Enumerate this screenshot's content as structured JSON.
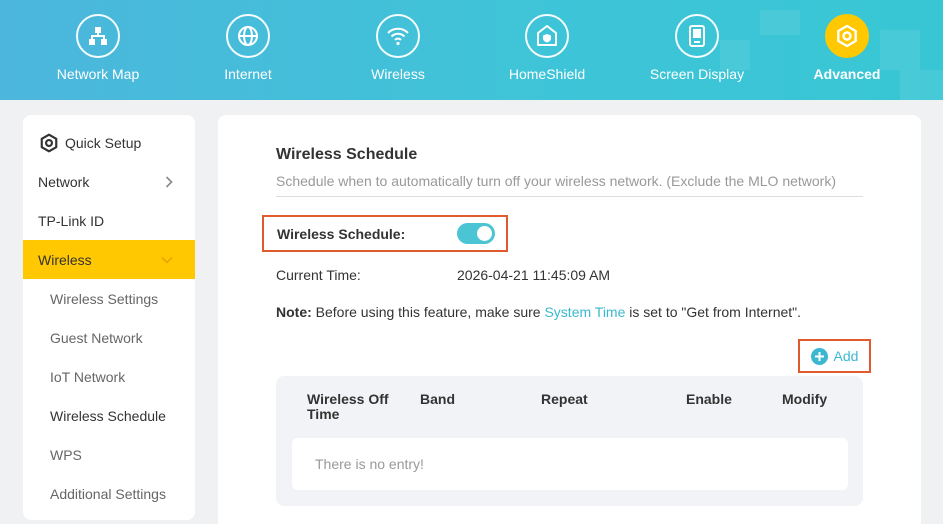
{
  "nav": {
    "items": [
      {
        "label": "Network Map",
        "icon": "network-map-icon"
      },
      {
        "label": "Internet",
        "icon": "globe-icon"
      },
      {
        "label": "Wireless",
        "icon": "wifi-icon"
      },
      {
        "label": "HomeShield",
        "icon": "homeshield-icon"
      },
      {
        "label": "Screen Display",
        "icon": "screen-display-icon"
      },
      {
        "label": "Advanced",
        "icon": "gear-icon"
      }
    ],
    "active": "Advanced"
  },
  "sidebar": {
    "items": [
      {
        "label": "Quick Setup"
      },
      {
        "label": "Network"
      },
      {
        "label": "TP-Link ID"
      },
      {
        "label": "Wireless"
      }
    ],
    "wireless_sub": [
      {
        "label": "Wireless Settings"
      },
      {
        "label": "Guest Network"
      },
      {
        "label": "IoT Network"
      },
      {
        "label": "Wireless Schedule"
      },
      {
        "label": "WPS"
      },
      {
        "label": "Additional Settings"
      }
    ]
  },
  "main": {
    "title": "Wireless Schedule",
    "subtitle": "Schedule when to automatically turn off your wireless network. (Exclude the MLO network)",
    "schedule_label": "Wireless Schedule:",
    "schedule_enabled": true,
    "current_time_label": "Current Time:",
    "current_time_value": "2026-04-21 11:45:09 AM",
    "note_prefix": "Note:",
    "note_text_1": " Before using this feature, make sure ",
    "note_link": "System Time",
    "note_text_2": " is set to \"Get from Internet\".",
    "add_label": "Add",
    "table": {
      "headers": {
        "off_time_line1": "Wireless Off",
        "off_time_line2": "Time",
        "band": "Band",
        "repeat": "Repeat",
        "enable": "Enable",
        "modify": "Modify"
      },
      "empty_text": "There is no entry!"
    }
  },
  "colors": {
    "accent": "#ffc800",
    "link": "#3bb8d0",
    "highlight_border": "#e05a2e",
    "toggle_on": "#4bc4d4"
  }
}
